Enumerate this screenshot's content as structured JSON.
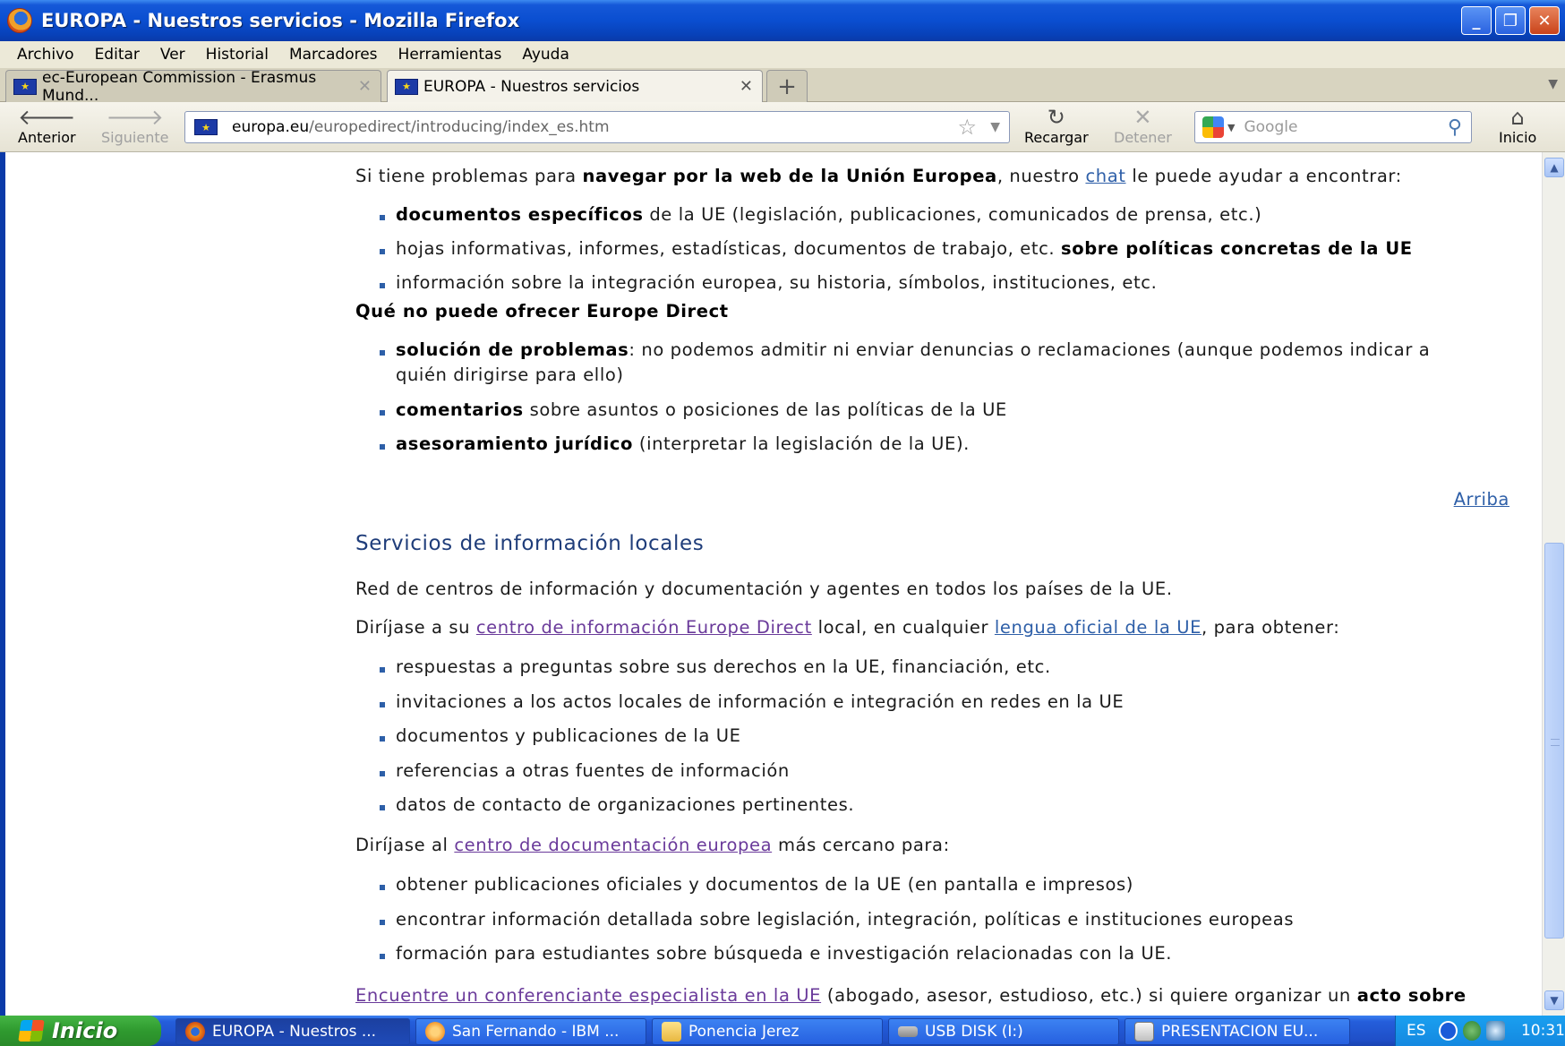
{
  "window": {
    "title": "EUROPA - Nuestros servicios - Mozilla Firefox"
  },
  "menu": [
    "Archivo",
    "Editar",
    "Ver",
    "Historial",
    "Marcadores",
    "Herramientas",
    "Ayuda"
  ],
  "tabs": [
    {
      "label": "ec-European Commission - Erasmus Mund...",
      "active": false
    },
    {
      "label": "EUROPA - Nuestros servicios",
      "active": true
    }
  ],
  "nav": {
    "back": "Anterior",
    "forward": "Siguiente",
    "reload": "Recargar",
    "stop": "Detener",
    "home": "Inicio",
    "url_host": "europa.eu",
    "url_path": "/europedirect/introducing/index_es.htm",
    "search_placeholder": "Google"
  },
  "content": {
    "intro": {
      "before": "Si tiene problemas para ",
      "bold": "navegar por la web de la Unión Europea",
      "middle": ", nuestro ",
      "link": "chat",
      "after": " le puede ayudar a encontrar:"
    },
    "list1": [
      {
        "bold": "documentos específicos",
        "text": " de la UE (legislación, publicaciones, comunicados de prensa, etc.)"
      },
      {
        "text": "hojas informativas, informes, estadísticas, documentos de trabajo, etc. ",
        "bold_after": "sobre políticas concretas de la UE"
      },
      {
        "text": "información sobre la integración europea, su historia, símbolos, instituciones, etc."
      }
    ],
    "no_offer_heading": "Qué no puede ofrecer Europe Direct",
    "list2": [
      {
        "bold": "solución de problemas",
        "text": ": no podemos admitir ni enviar denuncias o reclamaciones (aunque podemos indicar a quién dirigirse para ello)"
      },
      {
        "bold": "comentarios",
        "text": " sobre asuntos o posiciones de las políticas de la UE"
      },
      {
        "bold": "asesoramiento jurídico",
        "text": " (interpretar la legislación de la UE)."
      }
    ],
    "top_link": "Arriba",
    "section_title": "Servicios de información locales",
    "section_intro": "Red de centros de información y documentación y agentes en todos los países de la UE.",
    "contact_line": {
      "before": "Diríjase a su ",
      "link1": "centro de información Europe Direct",
      "middle": " local, en cualquier ",
      "link2": "lengua oficial de la UE",
      "after": ", para obtener:"
    },
    "list3": [
      "respuestas a preguntas sobre sus derechos en la UE, financiación, etc.",
      "invitaciones a los actos locales de información e integración en redes en la UE",
      "documentos y publicaciones de la UE",
      "referencias a otras fuentes de información",
      "datos de contacto de organizaciones pertinentes."
    ],
    "doc_line": {
      "before": "Diríjase al ",
      "link": "centro de documentación europea",
      "after": " más cercano para:"
    },
    "list4": [
      "obtener publicaciones oficiales y documentos de la UE (en pantalla e impresos)",
      "encontrar información detallada sobre legislación, integración, políticas e instituciones europeas",
      "formación para estudiantes sobre búsqueda e investigación relacionadas con la UE."
    ],
    "speaker_line": {
      "link": "Encuentre un conferenciante especialista en la UE",
      "text": " (abogado, asesor, estudioso, etc.) si quiere organizar un ",
      "bold": "acto sobre"
    }
  },
  "taskbar": {
    "start": "Inicio",
    "tasks": [
      "EUROPA - Nuestros ...",
      "San Fernando - IBM ...",
      "Ponencia Jerez",
      "USB DISK (I:)",
      "PRESENTACION EU..."
    ],
    "lang": "ES",
    "clock": "10:31"
  }
}
